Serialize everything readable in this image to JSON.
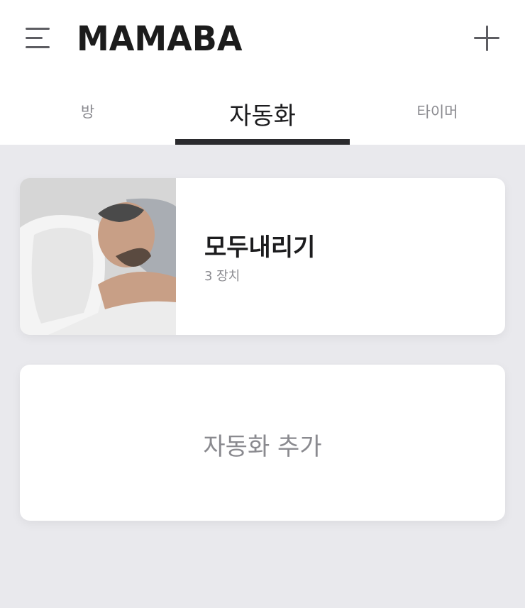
{
  "header": {
    "logo_text": "MAMABA",
    "menu_icon": "hamburger-icon",
    "add_icon": "plus-icon"
  },
  "tabs": [
    {
      "label": "방",
      "active": false
    },
    {
      "label": "자동화",
      "active": true
    },
    {
      "label": "타이머",
      "active": false
    }
  ],
  "automations": [
    {
      "title": "모두내리기",
      "subtitle": "3 장치"
    }
  ],
  "add_card": {
    "label": "자동화 추가"
  },
  "colors": {
    "background": "#e9e9ed",
    "header_bg": "#ffffff",
    "active_tab_underline": "#2b2b2e",
    "muted_text": "#8a8a8f"
  }
}
